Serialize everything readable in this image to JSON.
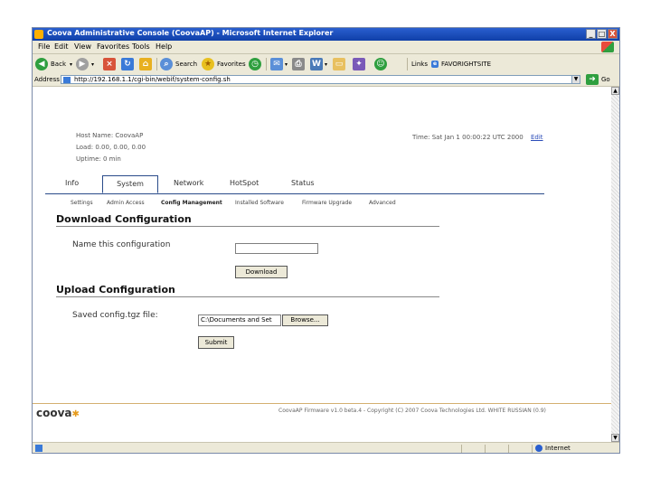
{
  "window": {
    "title": "Coova Administrative Console (CoovaAP) - Microsoft Internet Explorer",
    "controls": [
      "_",
      "□",
      "X"
    ]
  },
  "menu": [
    "File",
    "Edit",
    "View",
    "Favorites",
    "Tools",
    "Help"
  ],
  "toolbar": {
    "back": "Back",
    "search": "Search",
    "favorites": "Favorites",
    "links": "Links",
    "links_item": "FAVORIGHTSITE"
  },
  "address": {
    "label": "Address",
    "url": "http://192.168.1.1/cgi-bin/webif/system-config.sh",
    "go": "Go"
  },
  "header": {
    "host_name": "Host Name: CoovaAP",
    "load": "Load: 0.00, 0.00, 0.00",
    "uptime": "Uptime: 0 min",
    "time": "Time: Sat Jan 1 00:00:22 UTC 2000",
    "time_link": "Edit"
  },
  "main_tabs": [
    "Info",
    "System",
    "Network",
    "HotSpot",
    "Status"
  ],
  "sub_tabs": [
    "Settings",
    "Admin Access",
    "Config Management",
    "Installed Software",
    "Firmware Upgrade",
    "Advanced"
  ],
  "download": {
    "heading": "Download Configuration",
    "name_label": "Name this configuration",
    "name_value": "",
    "button": "Download"
  },
  "upload": {
    "heading": "Upload Configuration",
    "file_label": "Saved config.tgz file:",
    "file_value": "C:\\Documents and Set",
    "browse": "Browse...",
    "submit": "Submit"
  },
  "footer": {
    "logo": "coova",
    "copyright": "CoovaAP Firmware v1.0 beta.4 - Copyright (C) 2007 Coova Technologies Ltd. WHITE RUSSIAN (0.9)"
  },
  "status": {
    "zone": "Internet"
  },
  "colors": {
    "titlebar": "#0f3fa8",
    "chrome": "#ece9d8",
    "tab_border": "#2a4b8a",
    "logo_star": "#e69b1c"
  }
}
